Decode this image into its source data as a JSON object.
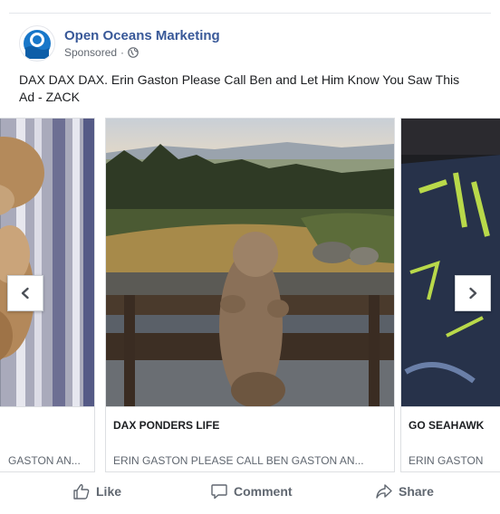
{
  "post": {
    "page_name": "Open Oceans Marketing",
    "sponsored_label": "Sponsored",
    "separator": "·",
    "caption": "DAX DAX DAX. Erin Gaston Please Call Ben and Let Him Know You Saw This Ad - ZACK"
  },
  "carousel": {
    "cards": [
      {
        "title": "",
        "subtitle": "GASTON AN..."
      },
      {
        "title": "DAX PONDERS LIFE",
        "subtitle": "ERIN GASTON PLEASE CALL BEN GASTON AN..."
      },
      {
        "title": "GO SEAHAWK",
        "subtitle": "ERIN GASTON"
      }
    ]
  },
  "actions": {
    "like": "Like",
    "comment": "Comment",
    "share": "Share"
  },
  "colors": {
    "brand_blue": "#385898",
    "secondary_text": "#606770",
    "border": "#dddfe2"
  },
  "icons": {
    "avatar": "ocean-logo-icon",
    "audience": "globe-icon",
    "prev": "chevron-left-icon",
    "next": "chevron-right-icon",
    "like": "thumbs-up-icon",
    "comment": "comment-bubble-icon",
    "share": "share-arrow-icon"
  }
}
